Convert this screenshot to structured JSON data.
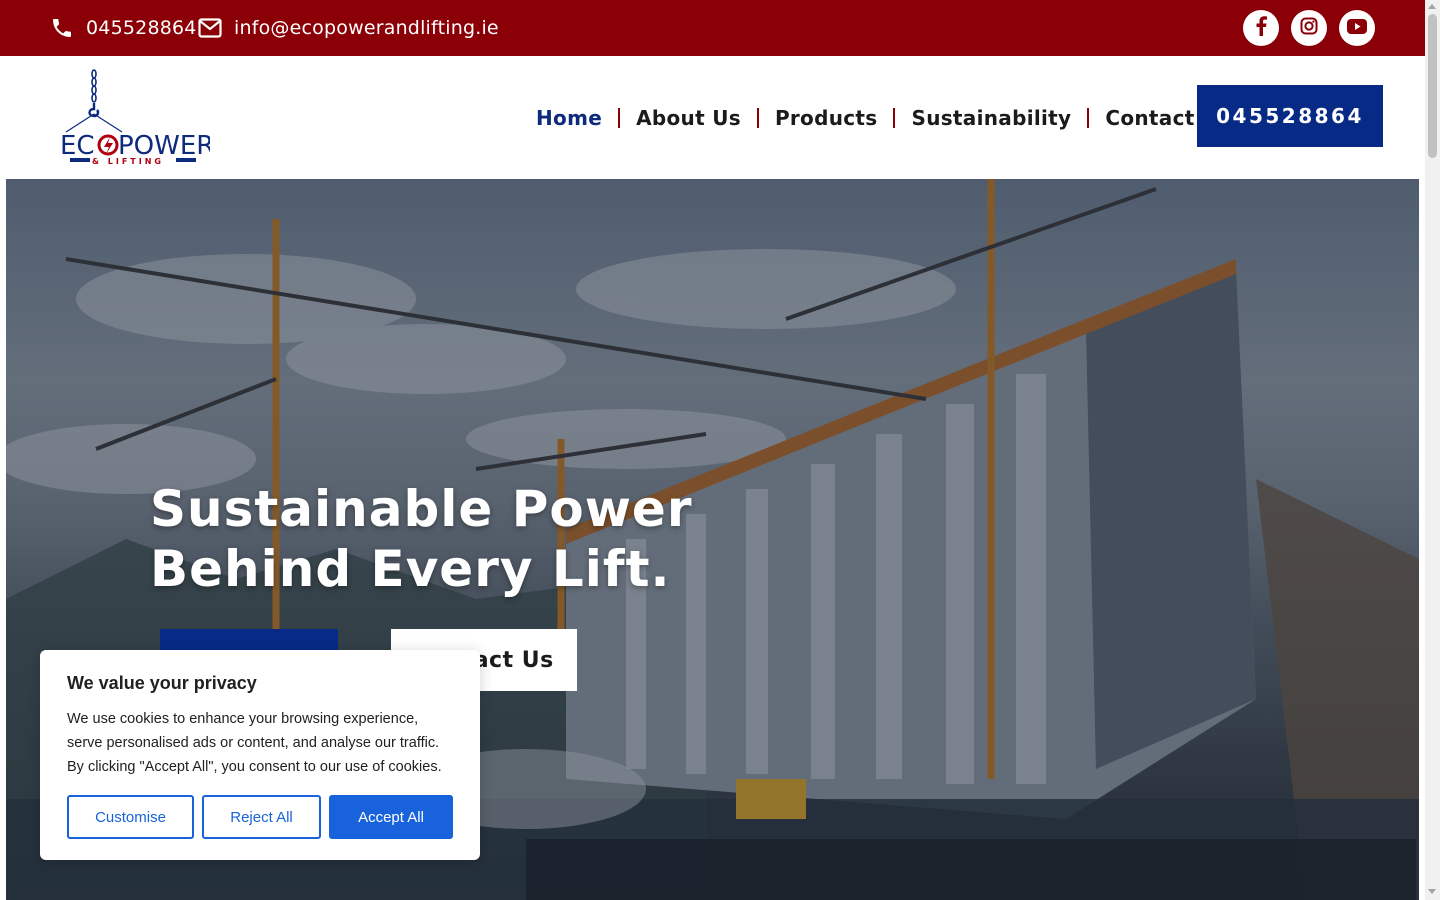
{
  "topbar": {
    "phone": "045528864",
    "email": "info@ecopowerandlifting.ie",
    "social": [
      "facebook-icon",
      "instagram-icon",
      "youtube-icon"
    ]
  },
  "header": {
    "logo": {
      "main": "ECOPOWER",
      "sub": "& LIFTING"
    },
    "nav": [
      {
        "label": "Home",
        "active": true
      },
      {
        "label": "About Us",
        "active": false
      },
      {
        "label": "Products",
        "active": false
      },
      {
        "label": "Sustainability",
        "active": false
      },
      {
        "label": "Contact Us",
        "active": false
      }
    ],
    "call_button": "045528864"
  },
  "hero": {
    "title_line1": "Sustainable Power",
    "title_line2": "Behind Every Lift.",
    "secondary_button": "Contact Us"
  },
  "cookie": {
    "title": "We value your privacy",
    "text": "We use cookies to enhance your browsing experience, serve personalised ads or content, and analyse our traffic. By clicking \"Accept All\", you consent to our use of cookies.",
    "customise": "Customise",
    "reject": "Reject All",
    "accept": "Accept All"
  },
  "colors": {
    "topbar_red": "#8b0007",
    "brand_blue": "#062a86",
    "cookie_blue": "#1863dc"
  }
}
